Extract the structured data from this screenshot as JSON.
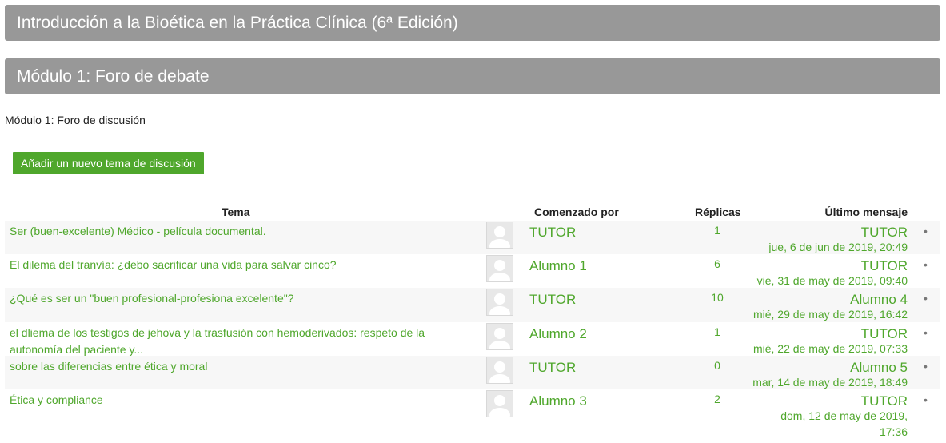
{
  "course": {
    "title": "Introducción a la Bioética en la Práctica Clínica (6ª Edición)"
  },
  "module": {
    "title": "Módulo 1: Foro de debate"
  },
  "forum": {
    "intro": "Módulo 1: Foro de discusión",
    "add_button": "Añadir un nuevo tema de discusión",
    "headers": {
      "topic": "Tema",
      "started_by": "Comenzado por",
      "replies": "Réplicas",
      "last_post": "Último mensaje"
    },
    "discussions": [
      {
        "topic": "Ser (buen-excelente) Médico - película documental.",
        "author": "TUTOR",
        "replies": "1",
        "last_author": "TUTOR",
        "last_date": "jue, 6 de jun de 2019, 20:49"
      },
      {
        "topic": "El dilema del tranvía: ¿debo sacrificar una vida para salvar cinco?",
        "author": "Alumno 1",
        "replies": "6",
        "last_author": "TUTOR",
        "last_date": "vie, 31 de may de 2019, 09:40"
      },
      {
        "topic": "¿Qué es ser un \"buen profesional-profesiona excelente\"?",
        "author": "TUTOR",
        "replies": "10",
        "last_author": "Alumno 4",
        "last_date": "mié, 29 de may de 2019, 16:42"
      },
      {
        "topic": "el dliema de los testigos de jehova y la trasfusión con hemoderivados: respeto de la autonomía del paciente y...",
        "author": "Alumno 2",
        "replies": "1",
        "last_author": "TUTOR",
        "last_date": "mié, 22 de may de 2019, 07:33"
      },
      {
        "topic": "sobre las diferencias entre ética y moral",
        "author": "TUTOR",
        "replies": "0",
        "last_author": "Alumno 5",
        "last_date": "mar, 14 de may de 2019, 18:49"
      },
      {
        "topic": "Ética y compliance",
        "author": "Alumno 3",
        "replies": "2",
        "last_author": "TUTOR",
        "last_date": "dom, 12 de may de 2019, 17:36"
      }
    ],
    "bullet_glyph": "•",
    "colors": {
      "accent": "#4fa72c",
      "banner": "#989898"
    }
  }
}
